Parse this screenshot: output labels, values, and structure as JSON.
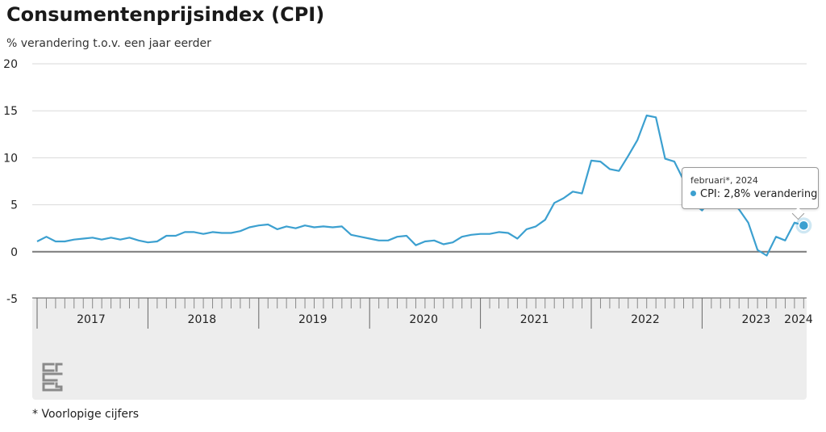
{
  "title": "Consumentenprijsindex (CPI)",
  "subtitle": "% verandering t.o.v. een jaar eerder",
  "footnote": "* Voorlopige cijfers",
  "logo_icon": "cbs-logo-icon",
  "colors": {
    "line": "#3ca0d0",
    "grid": "#d9d9d9",
    "zero": "#7a7a7a",
    "panel": "#ededed"
  },
  "tooltip": {
    "date": "februari*, 2024",
    "series": "CPI:",
    "value_text": "2,8% verandering"
  },
  "chart_data": {
    "type": "line",
    "ylim": [
      -5,
      20
    ],
    "yticks": [
      -5,
      0,
      5,
      10,
      15,
      20
    ],
    "grid": true,
    "legend": "none",
    "x_start": "2017-01",
    "years": [
      "2017",
      "2018",
      "2019",
      "2020",
      "2021",
      "2022",
      "2023",
      "2024"
    ],
    "series": [
      {
        "values": [
          1.1,
          1.6,
          1.1,
          1.1,
          1.3,
          1.4,
          1.5,
          1.3,
          1.5,
          1.3,
          1.5,
          1.2,
          1.0,
          1.1,
          1.7,
          1.7,
          2.1,
          2.1,
          1.9,
          2.1,
          2.0,
          2.0,
          2.2,
          2.6,
          2.8,
          2.9,
          2.4,
          2.7,
          2.5,
          2.8,
          2.6,
          2.7,
          2.6,
          2.7,
          1.8,
          1.6,
          1.4,
          1.2,
          1.2,
          1.6,
          1.7,
          0.7,
          1.1,
          1.2,
          0.8,
          1.0,
          1.6,
          1.8,
          1.9,
          1.9,
          2.1,
          2.0,
          1.4,
          2.4,
          2.7,
          3.4,
          5.2,
          5.7,
          6.4,
          6.2,
          9.7,
          9.6,
          8.8,
          8.6,
          10.2,
          11.9,
          14.5,
          14.3,
          9.9,
          9.6,
          7.6,
          5.2,
          4.4,
          5.6,
          5.4,
          5.5,
          4.5,
          3.1,
          0.2,
          -0.4,
          1.6,
          1.2,
          3.1,
          2.8
        ]
      }
    ]
  }
}
